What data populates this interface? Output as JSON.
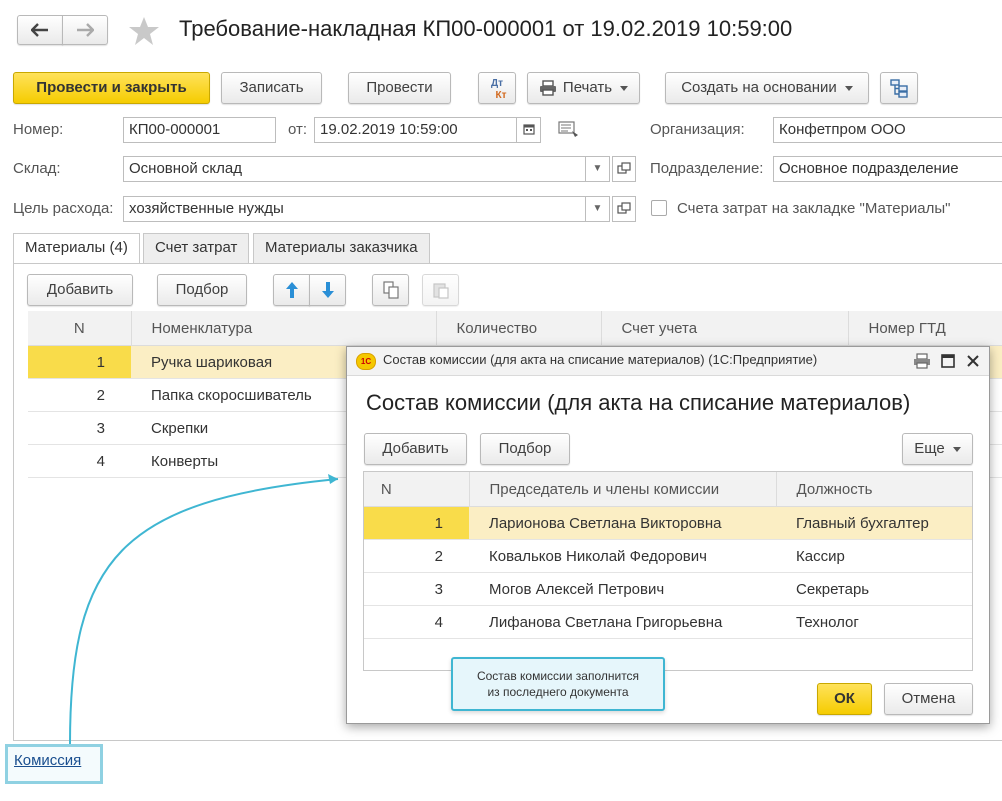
{
  "header": {
    "back_icon": "arrow-left-icon",
    "forward_icon": "arrow-right-icon",
    "favorite_icon": "star-icon",
    "title": "Требование-накладная КП00-000001 от 19.02.2019 10:59:00"
  },
  "toolbar": {
    "post_close": "Провести и закрыть",
    "save": "Записать",
    "post": "Провести",
    "dtkt_top": "Дт",
    "dtkt_bottom": "Кт",
    "print": "Печать",
    "create_based": "Создать на основании"
  },
  "form": {
    "number_label": "Номер:",
    "number_value": "КП00-000001",
    "date_label": "от:",
    "date_value": "19.02.2019 10:59:00",
    "org_label": "Организация:",
    "org_value": "Конфетпром ООО",
    "warehouse_label": "Склад:",
    "warehouse_value": "Основной склад",
    "division_label": "Подразделение:",
    "division_value": "Основное подразделение",
    "purpose_label": "Цель расхода:",
    "purpose_value": "хозяйственные нужды",
    "checkbox_label": "Счета затрат на закладке \"Материалы\""
  },
  "tabs": [
    {
      "label": "Материалы (4)",
      "active": true
    },
    {
      "label": "Счет затрат",
      "active": false
    },
    {
      "label": "Материалы заказчика",
      "active": false
    }
  ],
  "materials": {
    "add": "Добавить",
    "pick": "Подбор",
    "columns": [
      "N",
      "Номенклатура",
      "Количество",
      "Счет учета",
      "Номер ГТД"
    ],
    "rows": [
      {
        "n": "1",
        "name": "Ручка шариковая"
      },
      {
        "n": "2",
        "name": "Папка скоросшиватель"
      },
      {
        "n": "3",
        "name": "Скрепки"
      },
      {
        "n": "4",
        "name": "Конверты"
      }
    ]
  },
  "commission_link": "Комиссия",
  "dialog": {
    "logo": "1С",
    "window_title": "Состав комиссии (для акта на списание материалов) (1С:Предприятие)",
    "heading": "Состав комиссии (для акта на списание материалов)",
    "add": "Добавить",
    "pick": "Подбор",
    "more": "Еще",
    "columns": [
      "N",
      "Председатель и члены комиссии",
      "Должность"
    ],
    "rows": [
      {
        "n": "1",
        "name": "Ларионова Светлана Викторовна",
        "position": "Главный бухгалтер"
      },
      {
        "n": "2",
        "name": "Ковальков Николай Федорович",
        "position": "Кассир"
      },
      {
        "n": "3",
        "name": "Могов Алексей Петрович",
        "position": "Секретарь"
      },
      {
        "n": "4",
        "name": "Лифанова Светлана Григорьевна",
        "position": "Технолог"
      }
    ],
    "ok": "ОК",
    "cancel": "Отмена"
  },
  "tooltip": {
    "line1": "Состав комиссии заполнится",
    "line2": "из последнего документа"
  },
  "colors": {
    "accent_yellow": "#f5cc00",
    "selection": "#fbeec4",
    "callout": "#3fb6d2"
  }
}
